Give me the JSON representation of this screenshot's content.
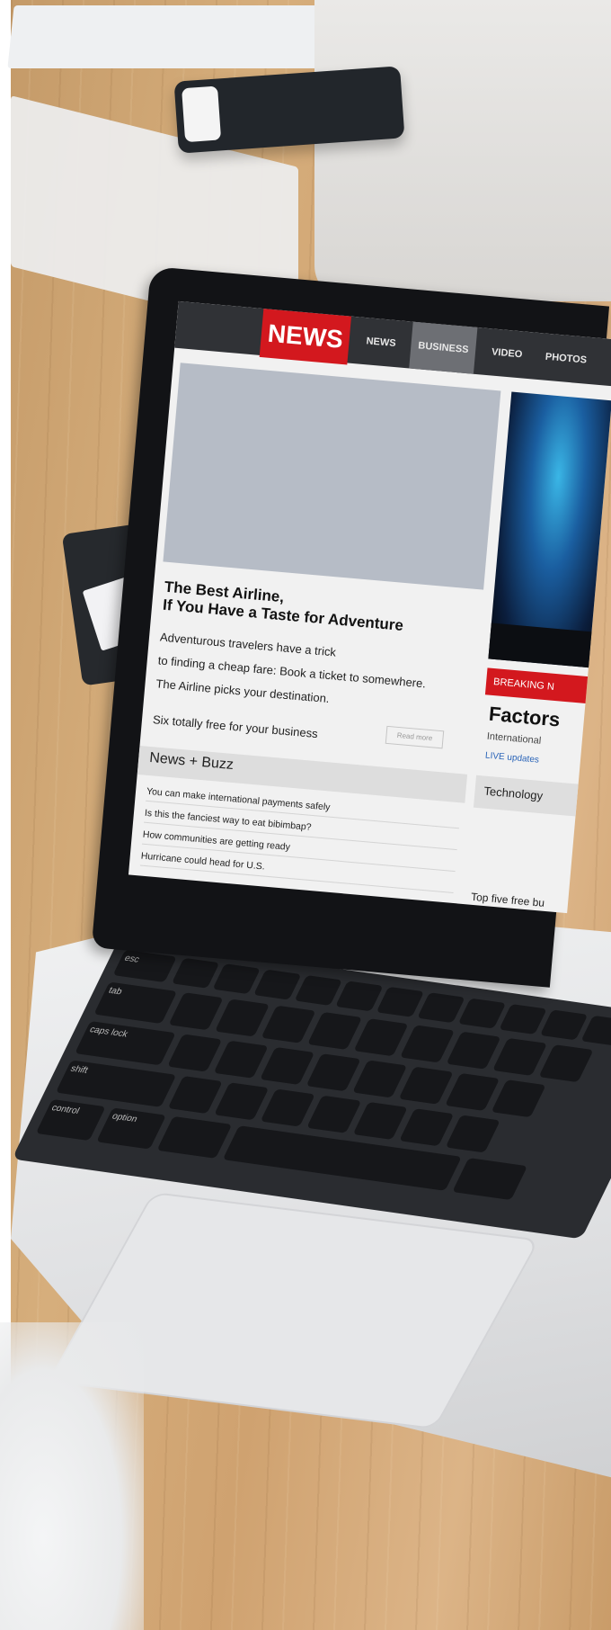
{
  "news_site": {
    "logo": "NEWS",
    "nav": [
      "NEWS",
      "BUSINESS",
      "VIDEO",
      "PHOTOS"
    ],
    "active_nav": "BUSINESS",
    "headline_line1": "The Best Airline,",
    "headline_line2": "If You Have a Taste for Adventure",
    "body_lines": [
      "Adventurous travelers have a trick",
      "to finding a cheap fare: Book a ticket to somewhere.",
      "The Airline picks your destination."
    ],
    "teaser": "Six totally free for your business",
    "read_more": "Read more",
    "section_title": "News + Buzz",
    "list": [
      "You can make international payments safely",
      "Is this the fanciest way to eat bibimbap?",
      "How communities are getting ready",
      "Hurricane could head for U.S."
    ],
    "breaking_label": "BREAKING N",
    "side_headline": "Factors",
    "side_sub": "International",
    "live_label": "LIVE updates",
    "side_section": "Technology",
    "side_bottom": "Top five free bu"
  },
  "keyboard_labels": [
    "esc",
    "tab",
    "caps lock",
    "shift",
    "control",
    "option"
  ],
  "colors": {
    "brand_red": "#d3181e",
    "nav_bg": "#303236",
    "link_blue": "#2a64b8"
  }
}
